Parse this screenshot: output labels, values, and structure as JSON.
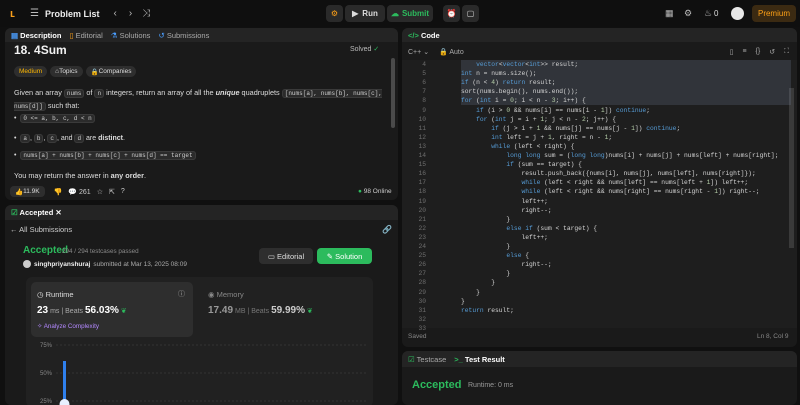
{
  "topbar": {
    "title": "Problem List",
    "run": "Run",
    "submit": "Submit",
    "streak": "0",
    "premium": "Premium"
  },
  "left": {
    "tabs": [
      "Description",
      "Editorial",
      "Solutions",
      "Submissions"
    ],
    "problem_title": "18. 4Sum",
    "status": "Solved",
    "tags": [
      "Medium",
      "Topics",
      "Companies"
    ],
    "desc1a": "Given an array ",
    "desc1b": "nums",
    "desc1c": " of ",
    "desc1d": "n",
    "desc1e": " integers, return an array of all the ",
    "desc1f": "unique",
    "desc1g": " quadruplets ",
    "desc_quad": "[nums[a], nums[b], nums[c], nums[d]]",
    "desc_such": " such that:",
    "b1": "0 <= a, b, c, d < n",
    "b2a": "a",
    "b2b": "b",
    "b2c": "c",
    "b2d": "d",
    "b2e": " are ",
    "b2f": "distinct",
    "b2g": ".",
    "b2and": ", and ",
    "b3": "nums[a] + nums[b] + nums[c] + nums[d] == target",
    "order_a": "You may return the answer in ",
    "order_b": "any order",
    "order_c": ".",
    "likes": "11.9K",
    "comments": "261",
    "online": "98 Online"
  },
  "accepted": {
    "tab": "Accepted",
    "all": "All Submissions",
    "status": "Accepted",
    "passed": "294 / 294 testcases passed",
    "user": "singhpriyanshuraj",
    "submitted": "submitted at Mar 13, 2025 08:09",
    "editorial": "Editorial",
    "solution": "Solution",
    "runtime_label": "Runtime",
    "runtime_val": "23",
    "runtime_unit": "ms",
    "beats": "| Beats",
    "runtime_pct": "56.03%",
    "memory_label": "Memory",
    "memory_val": "17.49",
    "memory_unit": "MB",
    "mem_beats": "| Beats",
    "memory_pct": "59.99%",
    "analyze": "Analyze Complexity"
  },
  "chart_data": {
    "type": "bar",
    "ticks": [
      "75%",
      "50%",
      "25%"
    ],
    "marker_value": "56.03%"
  },
  "code": {
    "tab": "Code",
    "lang": "C++",
    "auto": "Auto",
    "saved": "Saved",
    "pos": "Ln 8, Col 9",
    "lines": [
      {
        "n": "4",
        "t": "    vector<vector<int>> result;"
      },
      {
        "n": "5",
        "t": "int n = nums.size();"
      },
      {
        "n": "6",
        "t": "if (n < 4) return result;"
      },
      {
        "n": "7",
        "t": "sort(nums.begin(), nums.end());"
      },
      {
        "n": "8",
        "t": "for (int i = 0; i < n - 3; i++) {"
      },
      {
        "n": "9",
        "t": "    if (i > 0 && nums[i] == nums[i - 1]) continue;"
      },
      {
        "n": "10",
        "t": "    for (int j = i + 1; j < n - 2; j++) {"
      },
      {
        "n": "11",
        "t": "        if (j > i + 1 && nums[j] == nums[j - 1]) continue;"
      },
      {
        "n": "12",
        "t": "        int left = j + 1, right = n - 1;"
      },
      {
        "n": "13",
        "t": "        while (left < right) {"
      },
      {
        "n": "14",
        "t": "            long long sum = (long long)nums[i] + nums[j] + nums[left] + nums[right];"
      },
      {
        "n": "15",
        "t": "            if (sum == target) {"
      },
      {
        "n": "16",
        "t": "                result.push_back({nums[i], nums[j], nums[left], nums[right]});"
      },
      {
        "n": "17",
        "t": "                while (left < right && nums[left] == nums[left + 1]) left++;"
      },
      {
        "n": "18",
        "t": "                while (left < right && nums[right] == nums[right - 1]) right--;"
      },
      {
        "n": "19",
        "t": "                left++;"
      },
      {
        "n": "20",
        "t": "                right--;"
      },
      {
        "n": "21",
        "t": "            }"
      },
      {
        "n": "22",
        "t": "            else if (sum < target) {"
      },
      {
        "n": "23",
        "t": "                left++;"
      },
      {
        "n": "24",
        "t": "            }"
      },
      {
        "n": "25",
        "t": "            else {"
      },
      {
        "n": "26",
        "t": "                right--;"
      },
      {
        "n": "27",
        "t": "            }"
      },
      {
        "n": "28",
        "t": "        }"
      },
      {
        "n": "29",
        "t": "    }"
      },
      {
        "n": "30",
        "t": "}"
      },
      {
        "n": "31",
        "t": "return result;"
      },
      {
        "n": "32",
        "t": ""
      },
      {
        "n": "33",
        "t": ""
      }
    ]
  },
  "result": {
    "testcase": "Testcase",
    "test_result": "Test Result",
    "status": "Accepted",
    "runtime": "Runtime: 0 ms"
  }
}
